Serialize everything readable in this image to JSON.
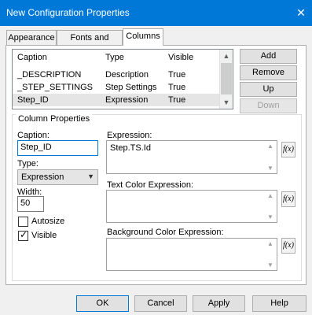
{
  "window": {
    "title": "New Configuration Properties",
    "close_glyph": "✕"
  },
  "tabs": [
    {
      "label": "Appearance"
    },
    {
      "label": "Fonts and Colors"
    },
    {
      "label": "Columns"
    }
  ],
  "columns_list": {
    "headers": [
      "Caption",
      "Type",
      "Visible"
    ],
    "rows": [
      {
        "caption": "_DESCRIPTION",
        "type": "Description",
        "visible": "True"
      },
      {
        "caption": "_STEP_SETTINGS",
        "type": "Step Settings",
        "visible": "True"
      },
      {
        "caption": "Step_ID",
        "type": "Expression",
        "visible": "True"
      }
    ]
  },
  "side_buttons": {
    "add": "Add",
    "remove": "Remove",
    "up": "Up",
    "down": "Down"
  },
  "column_properties": {
    "group_label": "Column Properties",
    "caption_label": "Caption:",
    "caption_value": "Step_ID",
    "type_label": "Type:",
    "type_value": "Expression",
    "width_label": "Width:",
    "width_value": "50",
    "autosize_label": "Autosize",
    "visible_label": "Visible",
    "expression_label": "Expression:",
    "expression_value": "Step.TS.Id",
    "text_color_label": "Text Color Expression:",
    "bg_color_label": "Background Color Expression:",
    "fx_label": "f(x)"
  },
  "footer_buttons": {
    "ok": "OK",
    "cancel": "Cancel",
    "apply": "Apply",
    "help": "Help"
  }
}
